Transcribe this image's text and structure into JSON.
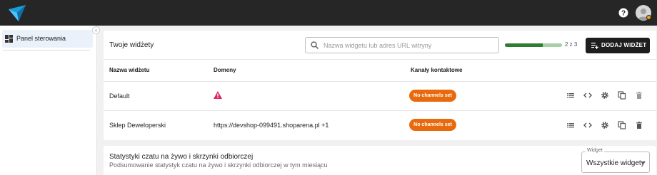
{
  "sidebar": {
    "items": [
      {
        "label": "Panel sterowania",
        "icon": "dashboard-icon"
      }
    ],
    "collapse_glyph": "‹"
  },
  "widgets": {
    "title": "Twoje widżety",
    "search_placeholder": "Nazwa widgetu lub adres URL witryny",
    "usage": {
      "text": "2 z 3",
      "used": 2,
      "limit": 3
    },
    "add_button": "DODAJ WIDŻET",
    "columns": [
      "Nazwa widżetu",
      "Domeny",
      "Kanały kontaktowe"
    ],
    "rows": [
      {
        "name": "Default",
        "domain": "",
        "domain_warning": true,
        "channels": "No channels set"
      },
      {
        "name": "Sklep Deweloperski",
        "domain": "https://devshop-099491.shoparena.pl +1",
        "domain_warning": false,
        "channels": "No channels set"
      }
    ],
    "row_actions": [
      "list-icon",
      "code-icon",
      "settings-icon",
      "copy-icon",
      "delete-icon"
    ]
  },
  "stats": {
    "title": "Statystyki czatu na żywo i skrzynki odbiorczej",
    "subtitle": "Podsumowanie statystyk czatu na żywo i skrzynki odbiorczej w tym miesiącu",
    "select_label": "Widget",
    "select_value": "Wszystkie widgety"
  },
  "colors": {
    "topbar": "#262626",
    "badge": "#e96a0d",
    "warning": "#e0245e",
    "progress_fill": "#2e7d32",
    "progress_track": "#a6cfa6",
    "logo_primary": "#1a9bd7"
  }
}
